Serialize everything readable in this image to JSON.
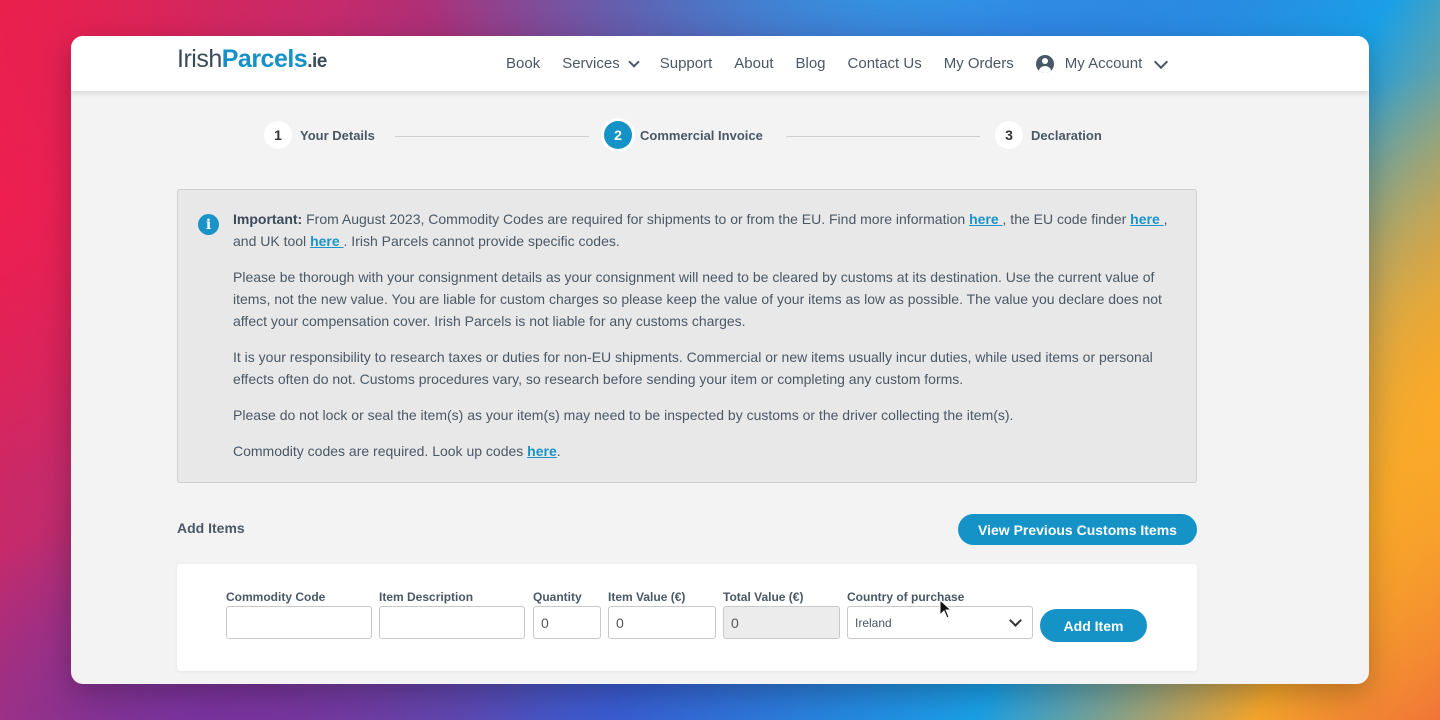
{
  "logo": {
    "irish": "Irish",
    "parcels": "Parcels",
    "ie": ".ie"
  },
  "nav": {
    "items": [
      {
        "label": "Book"
      },
      {
        "label": "Services"
      },
      {
        "label": "Support"
      },
      {
        "label": "About"
      },
      {
        "label": "Blog"
      },
      {
        "label": "Contact Us"
      },
      {
        "label": "My Orders"
      },
      {
        "label": "My Account"
      }
    ],
    "icons": {
      "services_dropdown": "chevron-down-icon",
      "account": "user-circle-icon",
      "account_dropdown": "chevron-down-icon"
    }
  },
  "stepper": {
    "steps": [
      {
        "number": "1",
        "label": "Your Details"
      },
      {
        "number": "2",
        "label": "Commercial Invoice"
      },
      {
        "number": "3",
        "label": "Declaration"
      }
    ],
    "active_step": 2
  },
  "info": {
    "icon": "info-icon",
    "p1": {
      "bold": "Important:",
      "t1": " From August 2023, Commodity Codes are required for shipments to or from the EU. Find more information ",
      "link1": "here ",
      "t2": ", the EU code finder ",
      "link2": "here ",
      "t3": ", and UK tool ",
      "link3": "here ",
      "t4": ". Irish Parcels cannot provide specific codes."
    },
    "p2": "Please be thorough with your consignment details as your consignment will need to be cleared by customs at its destination. Use the current value of items, not the new value. You are liable for custom charges so please keep the value of your items as low as possible. The value you declare does not affect your compensation cover. Irish Parcels is not liable for any customs charges.",
    "p3": "It is your responsibility to research taxes or duties for non-EU shipments. Commercial or new items usually incur duties, while used items or personal effects often do not. Customs procedures vary, so research before sending your item or completing any custom forms.",
    "p4": "Please do not lock or seal the item(s) as your item(s) may need to be inspected by customs or the driver collecting the item(s).",
    "p5": {
      "text": "Commodity codes are required. Look up codes ",
      "link": "here",
      "end": "."
    }
  },
  "add_items": {
    "title": "Add Items",
    "view_previous_label": "View Previous Customs Items",
    "fields": {
      "commodity_code": {
        "label": "Commodity Code",
        "value": ""
      },
      "item_description": {
        "label": "Item Description",
        "value": ""
      },
      "quantity": {
        "label": "Quantity",
        "value": "0"
      },
      "item_value": {
        "label": "Item Value (€)",
        "value": "0"
      },
      "total_value": {
        "label": "Total Value (€)",
        "value": "0"
      },
      "country": {
        "label": "Country of purchase",
        "value": "Ireland"
      }
    },
    "add_item_label": "Add Item"
  },
  "colors": {
    "accent": "#1593c7",
    "text": "#4a5866",
    "panel": "#e8e8e8"
  }
}
